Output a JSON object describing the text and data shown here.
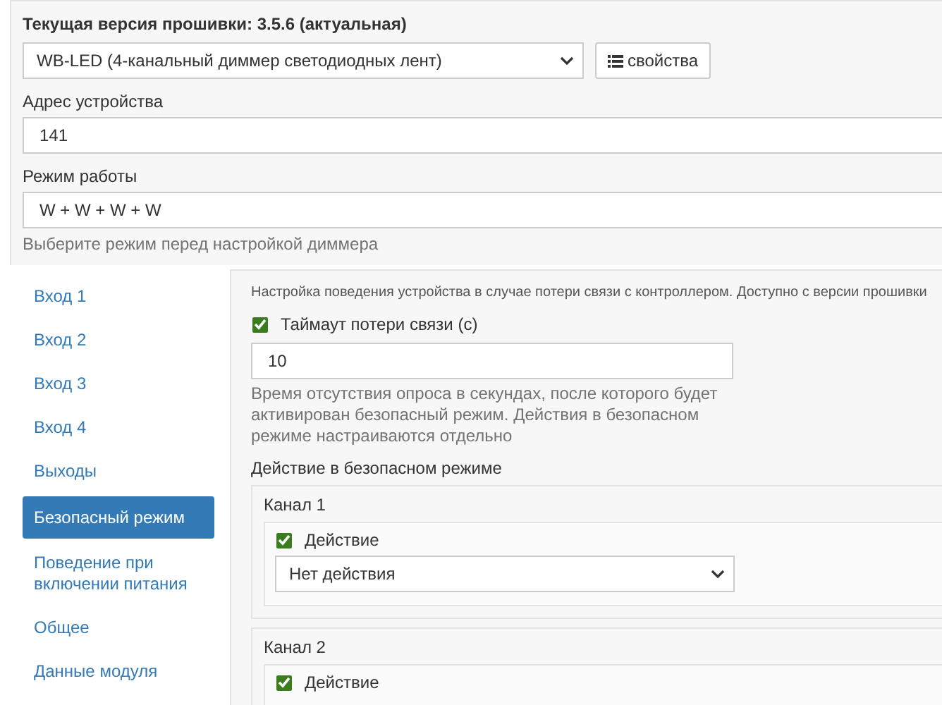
{
  "firmware": {
    "label": "Текущая версия прошивки: 3.5.6 (актуальная)"
  },
  "device_select": {
    "value": "WB-LED (4-канальный диммер светодиодных лент)"
  },
  "properties_button": {
    "label": "свойства"
  },
  "address": {
    "label": "Адрес устройства",
    "value": "141"
  },
  "mode": {
    "label": "Режим работы",
    "value": "W + W + W + W",
    "help": "Выберите режим перед настройкой диммера"
  },
  "sidebar": {
    "items": [
      {
        "label": "Вход 1",
        "selected": false
      },
      {
        "label": "Вход 2",
        "selected": false
      },
      {
        "label": "Вход 3",
        "selected": false
      },
      {
        "label": "Вход 4",
        "selected": false
      },
      {
        "label": "Выходы",
        "selected": false
      },
      {
        "label": "Безопасный режим",
        "selected": true
      },
      {
        "label": "Поведение при включении питания",
        "selected": false
      },
      {
        "label": "Общее",
        "selected": false
      },
      {
        "label": "Данные модуля",
        "selected": false
      }
    ]
  },
  "panel": {
    "description": "Настройка поведения устройства в случае потери связи с контроллером. Доступно с версии прошивки",
    "timeout": {
      "label": "Таймаут потери связи (с)",
      "checked": true,
      "value": "10",
      "help": "Время отсутствия опроса в секундах, после которого будет активирован безопасный режим. Действия в безопасном режиме настраиваются отдельно"
    },
    "actions_title": "Действие в безопасном режиме",
    "channels": [
      {
        "title": "Канал 1",
        "action_label": "Действие",
        "checked": true,
        "value": "Нет действия"
      },
      {
        "title": "Канал 2",
        "action_label": "Действие",
        "checked": true
      }
    ]
  }
}
